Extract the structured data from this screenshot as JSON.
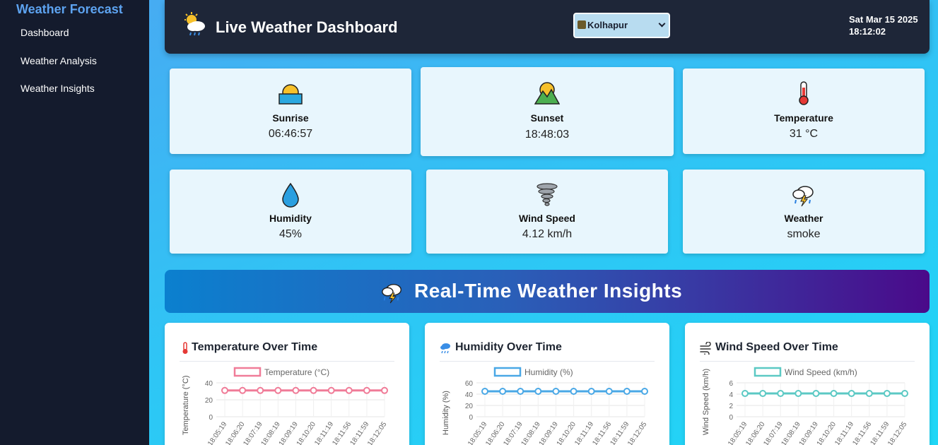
{
  "sidebar": {
    "brand": "Weather Forecast",
    "items": [
      {
        "label": "Dashboard"
      },
      {
        "label": "Weather Analysis"
      },
      {
        "label": "Weather Insights"
      }
    ]
  },
  "header": {
    "title": "Live Weather Dashboard",
    "city": "Kolhapur",
    "date": "Sat Mar 15 2025",
    "time": "18:12:02"
  },
  "cards": [
    {
      "label": "Sunrise",
      "value": "06:46:57",
      "icon": "sunrise-icon"
    },
    {
      "label": "Sunset",
      "value": "18:48:03",
      "icon": "sunset-icon"
    },
    {
      "label": "Temperature",
      "value": "31 °C",
      "icon": "thermometer-icon"
    },
    {
      "label": "Humidity",
      "value": "45%",
      "icon": "droplet-icon"
    },
    {
      "label": "Wind Speed",
      "value": "4.12 km/h",
      "icon": "tornado-icon"
    },
    {
      "label": "Weather",
      "value": "smoke",
      "icon": "storm-cloud-icon"
    }
  ],
  "banner": {
    "title": "Real-Time Weather Insights",
    "icon": "storm-cloud-icon"
  },
  "colors": {
    "temperature": "#f07c98",
    "humidity": "#4aa8e6",
    "wind": "#5cc9c4"
  },
  "chart_data": [
    {
      "type": "line",
      "title": "Temperature Over Time",
      "ylabel": "Temperature (°C)",
      "ylim": [
        0,
        40
      ],
      "yticks": [
        0,
        20,
        40
      ],
      "x": [
        "18:05:19",
        "18:06:20",
        "18:07:19",
        "18:08:19",
        "18:09:19",
        "18:10:20",
        "18:11:19",
        "18:11:56",
        "18:11:59",
        "18:12:05"
      ],
      "series": [
        {
          "name": "Temperature (°C)",
          "values": [
            31,
            31,
            31,
            31,
            31,
            31,
            31,
            31,
            31,
            31
          ]
        }
      ]
    },
    {
      "type": "line",
      "title": "Humidity Over Time",
      "ylabel": "Humidity (%)",
      "ylim": [
        0,
        60
      ],
      "yticks": [
        0,
        20,
        40,
        60
      ],
      "x": [
        "18:05:19",
        "18:06:20",
        "18:07:19",
        "18:08:19",
        "18:09:19",
        "18:10:20",
        "18:11:19",
        "18:11:56",
        "18:11:59",
        "18:12:05"
      ],
      "series": [
        {
          "name": "Humidity (%)",
          "values": [
            45,
            45,
            45,
            45,
            45,
            45,
            45,
            45,
            45,
            45
          ]
        }
      ]
    },
    {
      "type": "line",
      "title": "Wind Speed Over Time",
      "ylabel": "Wind Speed (km/h)",
      "ylim": [
        0,
        6
      ],
      "yticks": [
        0,
        2,
        4,
        6
      ],
      "x": [
        "18:05:19",
        "18:06:20",
        "18:07:19",
        "18:08:19",
        "18:09:19",
        "18:10:20",
        "18:11:19",
        "18:11:56",
        "18:11:59",
        "18:12:05"
      ],
      "series": [
        {
          "name": "Wind Speed (km/h)",
          "values": [
            4.12,
            4.12,
            4.12,
            4.12,
            4.12,
            4.12,
            4.12,
            4.12,
            4.12,
            4.12
          ]
        }
      ]
    }
  ]
}
